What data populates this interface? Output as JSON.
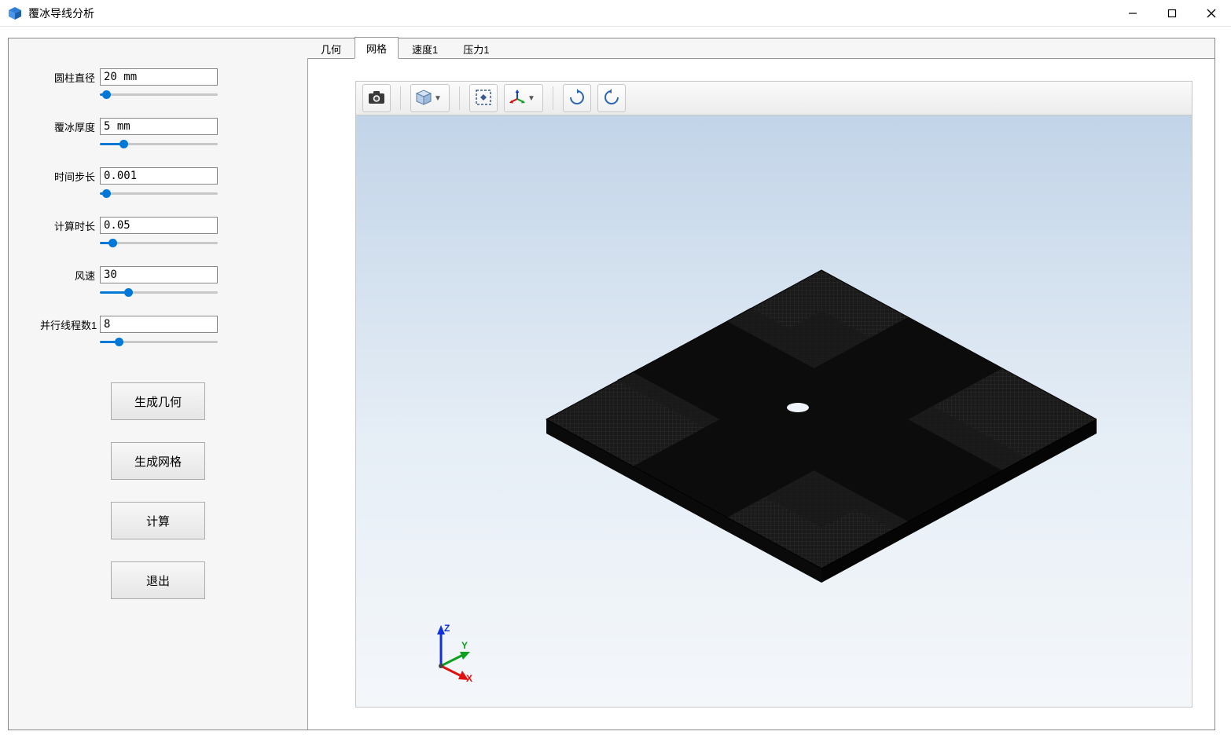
{
  "window": {
    "title": "覆冰导线分析"
  },
  "params": {
    "diameter": {
      "label": "圆柱直径",
      "value": "20 mm",
      "slider_pct": 2
    },
    "ice": {
      "label": "覆冰厚度",
      "value": "5 mm",
      "slider_pct": 18
    },
    "timestep": {
      "label": "时间步长",
      "value": "0.001",
      "slider_pct": 2
    },
    "duration": {
      "label": "计算时长",
      "value": "0.05",
      "slider_pct": 8
    },
    "windspeed": {
      "label": "风速",
      "value": "30",
      "slider_pct": 22
    },
    "threads": {
      "label": "并行线程数1",
      "value": "8",
      "slider_pct": 14
    }
  },
  "buttons": {
    "gen_geom": "生成几何",
    "gen_mesh": "生成网格",
    "compute": "计算",
    "exit": "退出"
  },
  "tabs": {
    "items": [
      {
        "id": "geom",
        "label": "几何"
      },
      {
        "id": "mesh",
        "label": "网格"
      },
      {
        "id": "vel",
        "label": "速度1"
      },
      {
        "id": "press",
        "label": "压力1"
      }
    ],
    "active": "mesh"
  },
  "toolbar3d": {
    "icons": {
      "screenshot": "screenshot-icon",
      "view_cube": "view-cube-icon",
      "fit": "fit-view-icon",
      "axes": "axes-triad-icon",
      "rotate_cw": "rotate-cw-icon",
      "rotate_ccw": "rotate-ccw-icon"
    }
  },
  "triad": {
    "x": "X",
    "y": "Y",
    "z": "Z"
  }
}
